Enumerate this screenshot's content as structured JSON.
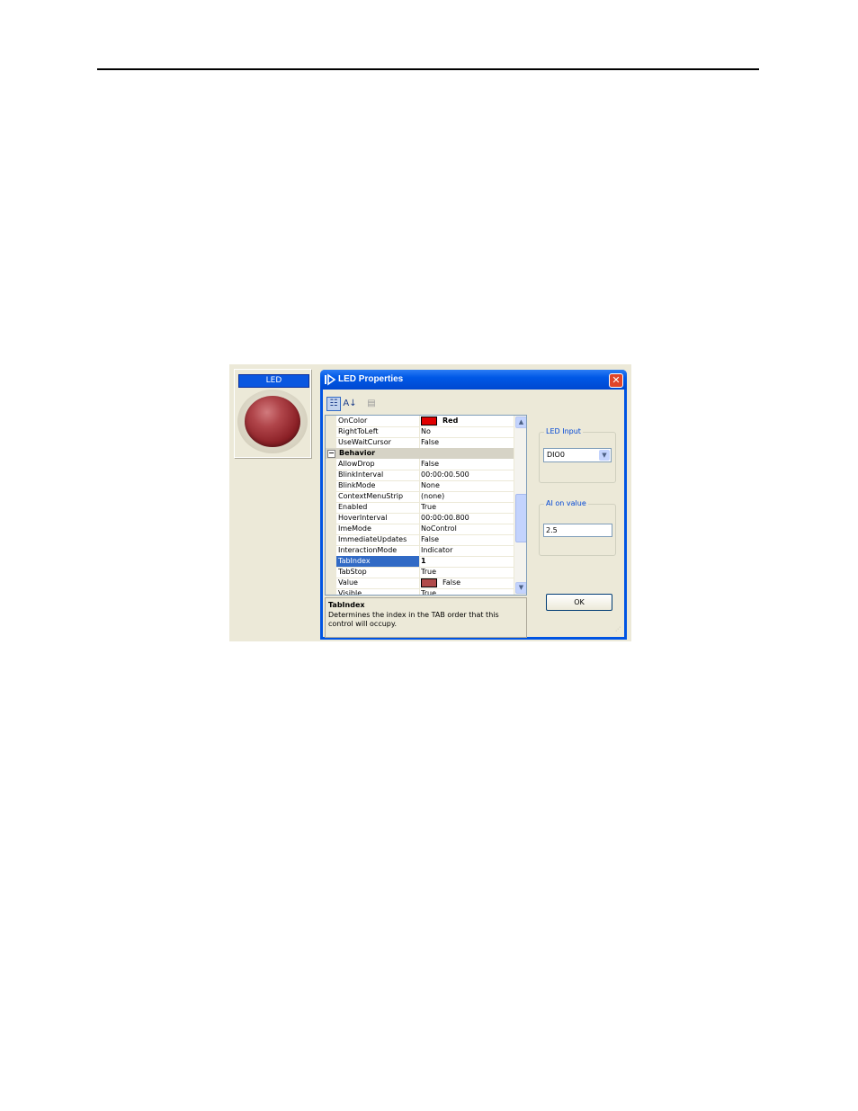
{
  "led_panel": {
    "title": "LED"
  },
  "dialog": {
    "title": "LED Properties",
    "close_glyph": "✕",
    "toolbar": [
      {
        "name": "categorized-icon",
        "glyph": "☷",
        "active": true
      },
      {
        "name": "alphabetical-icon",
        "glyph": "A↓",
        "active": false
      },
      {
        "name": "property-pages-icon",
        "glyph": "▤",
        "active": false
      }
    ],
    "grid": {
      "rows_top": [
        {
          "name": "OnColor",
          "value": "Red",
          "swatch": "#e00000",
          "bold": true
        },
        {
          "name": "RightToLeft",
          "value": "No"
        },
        {
          "name": "UseWaitCursor",
          "value": "False"
        }
      ],
      "category": {
        "toggle": "⊟",
        "label": "Behavior"
      },
      "rows_behavior": [
        {
          "name": "AllowDrop",
          "value": "False"
        },
        {
          "name": "BlinkInterval",
          "value": "00:00:00.500"
        },
        {
          "name": "BlinkMode",
          "value": "None"
        },
        {
          "name": "ContextMenuStrip",
          "value": "(none)"
        },
        {
          "name": "Enabled",
          "value": "True"
        },
        {
          "name": "HoverInterval",
          "value": "00:00:00.800"
        },
        {
          "name": "ImeMode",
          "value": "NoControl"
        },
        {
          "name": "ImmediateUpdates",
          "value": "False"
        },
        {
          "name": "InteractionMode",
          "value": "Indicator"
        },
        {
          "name": "TabIndex",
          "value": "1",
          "selected": true
        },
        {
          "name": "TabStop",
          "value": "True"
        },
        {
          "name": "Value",
          "value": "False",
          "swatch": "#b04a4a"
        },
        {
          "name": "Visible",
          "value": "True"
        }
      ]
    },
    "description": {
      "title": "TabIndex",
      "text": "Determines the index in the TAB order that this control will occupy."
    },
    "led_input": {
      "legend": "LED Input",
      "selected": "DIO0"
    },
    "ai_on_value": {
      "legend": "AI on value",
      "value": "2.5"
    },
    "ok_label": "OK"
  },
  "colors": {
    "titlebar": "#0058e6",
    "selection": "#316ac5",
    "window_face": "#ece9d8",
    "led": "#8c2127"
  }
}
